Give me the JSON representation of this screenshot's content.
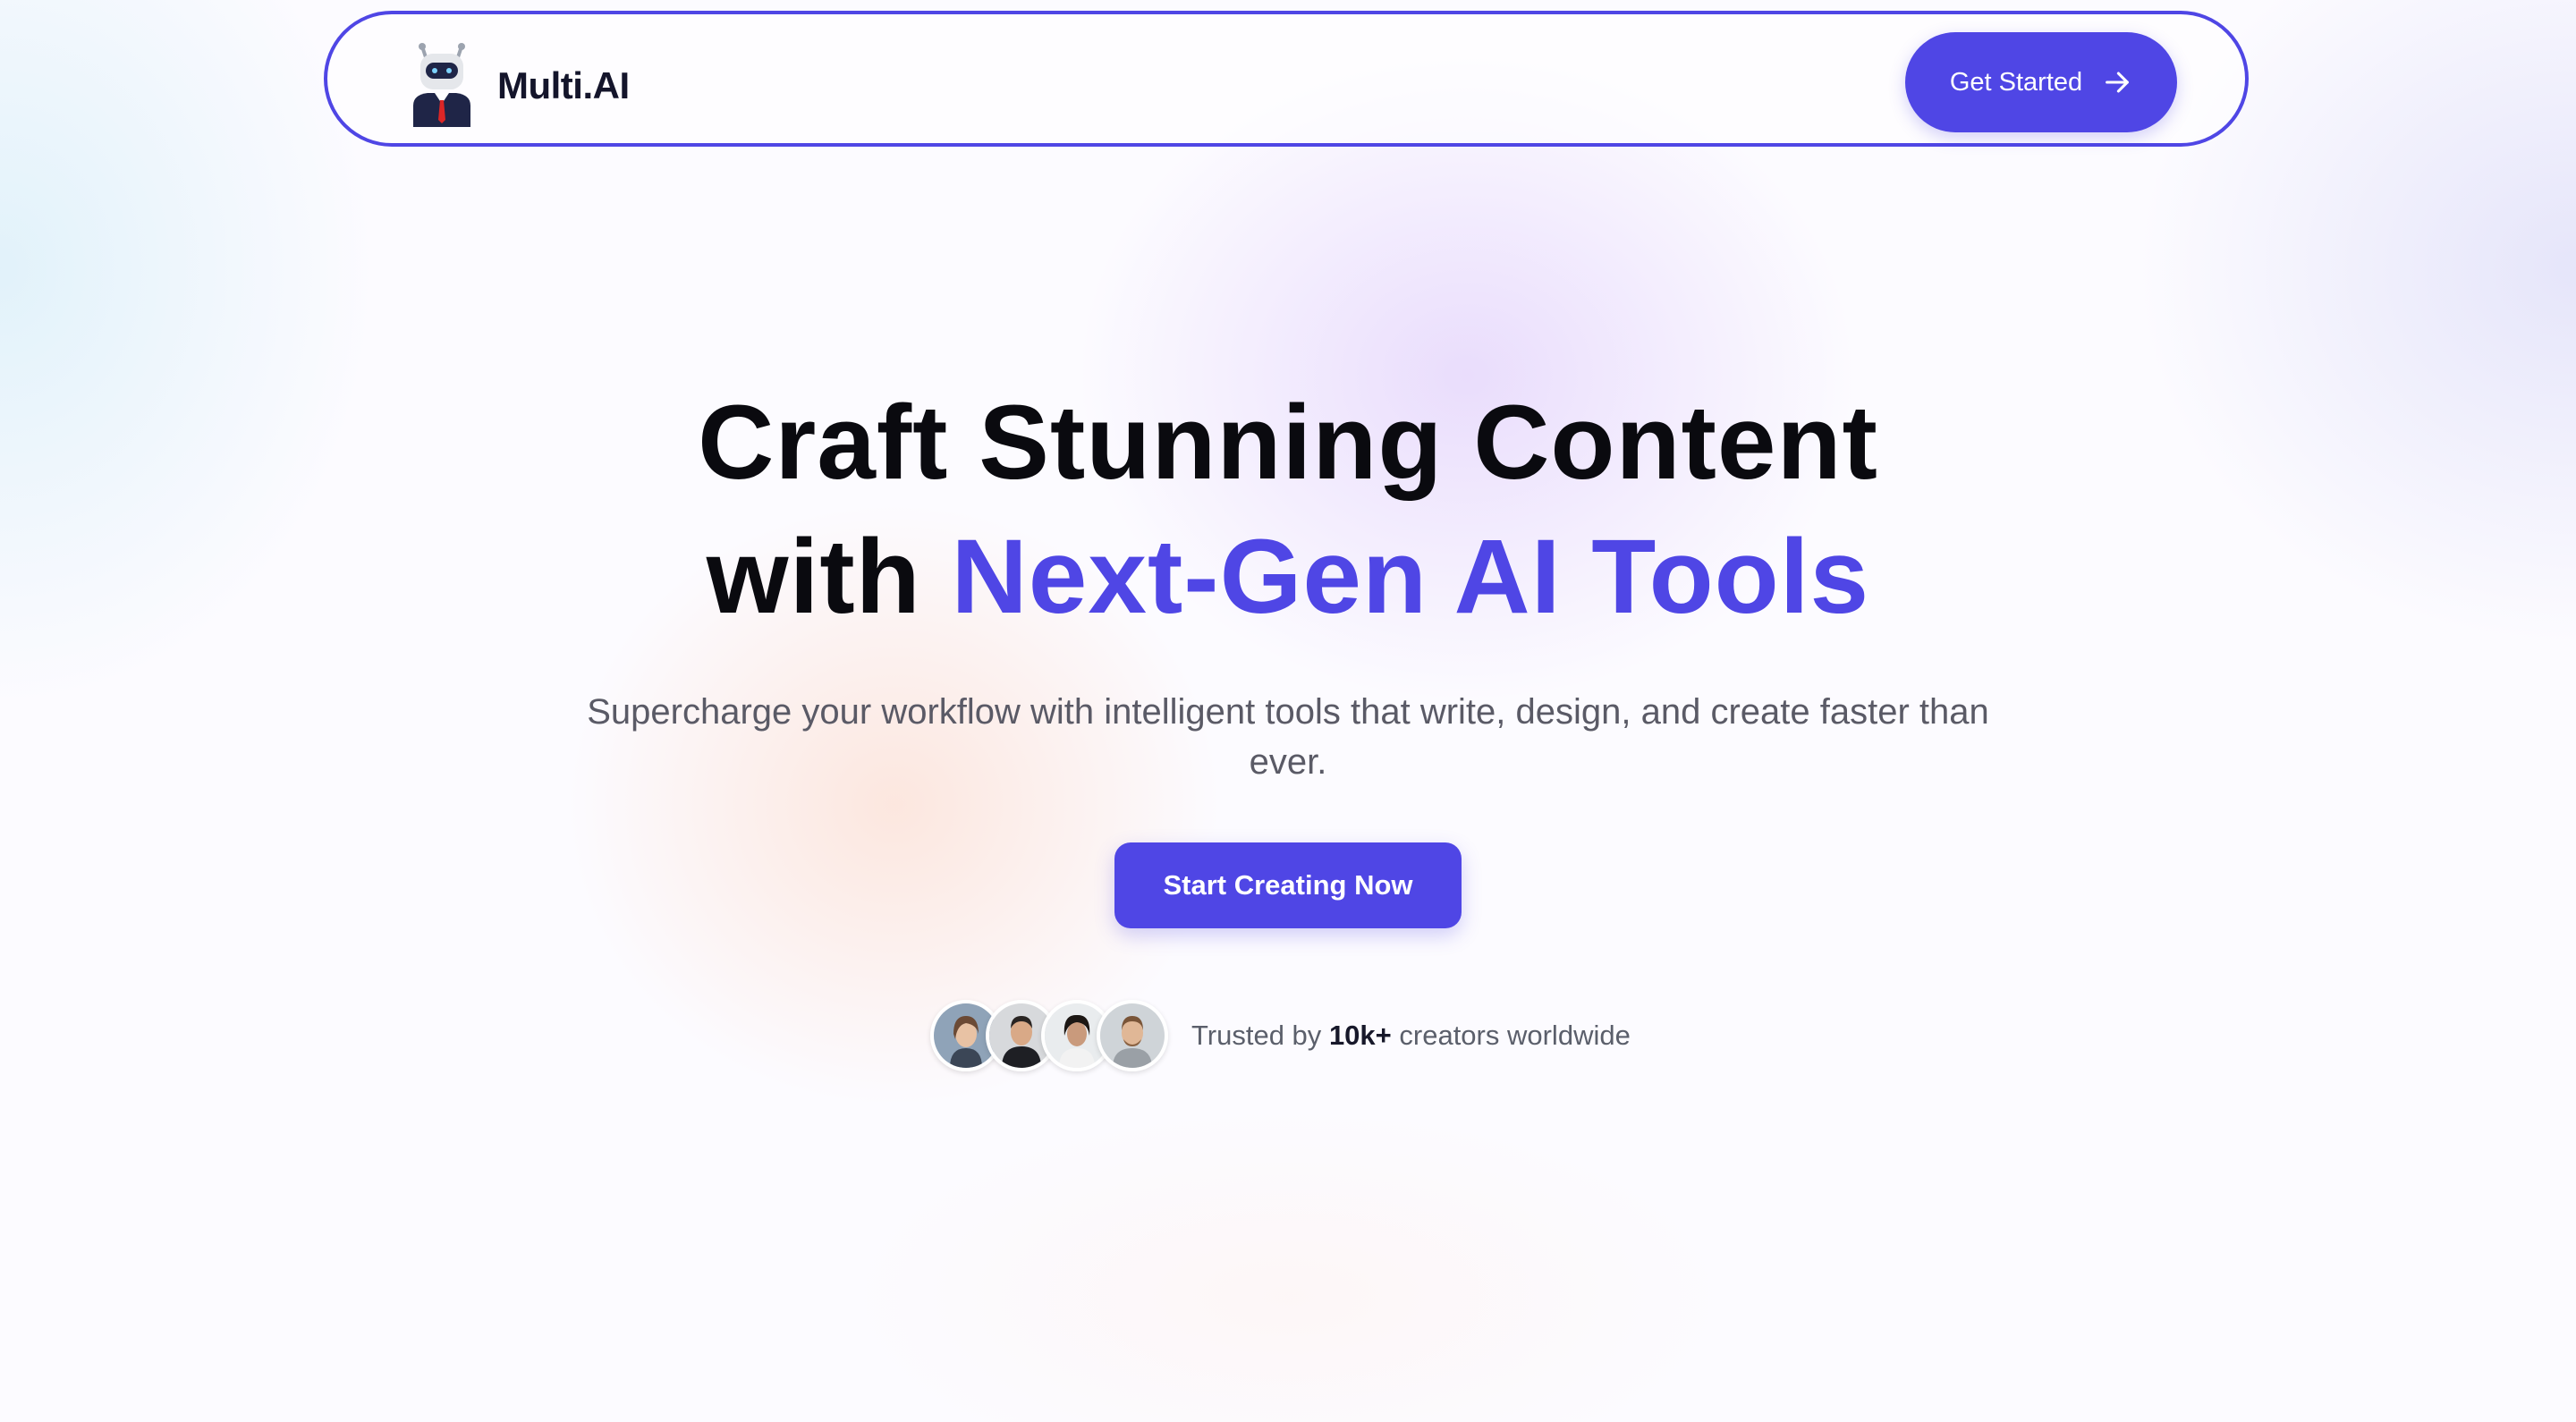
{
  "nav": {
    "brand": "Multi.AI",
    "logo_icon": "robot-icon",
    "get_started_label": "Get Started",
    "get_started_icon": "arrow-right-icon"
  },
  "hero": {
    "title_line1": "Craft Stunning Content",
    "title_line2_plain": "with",
    "title_line2_accent": "Next-Gen AI Tools",
    "subtitle": "Supercharge your workflow with intelligent tools that write, design, and create faster than ever.",
    "cta_label": "Start Creating Now"
  },
  "trust": {
    "prefix": "Trusted by",
    "highlight": "10k+",
    "suffix": "creators worldwide",
    "avatars": [
      "avatar-1",
      "avatar-2",
      "avatar-3",
      "avatar-4"
    ]
  },
  "colors": {
    "accent": "#4f46e5",
    "title": "#0a0a0f",
    "subtitle": "#5a5a66",
    "muted": "#5b5f6b"
  }
}
